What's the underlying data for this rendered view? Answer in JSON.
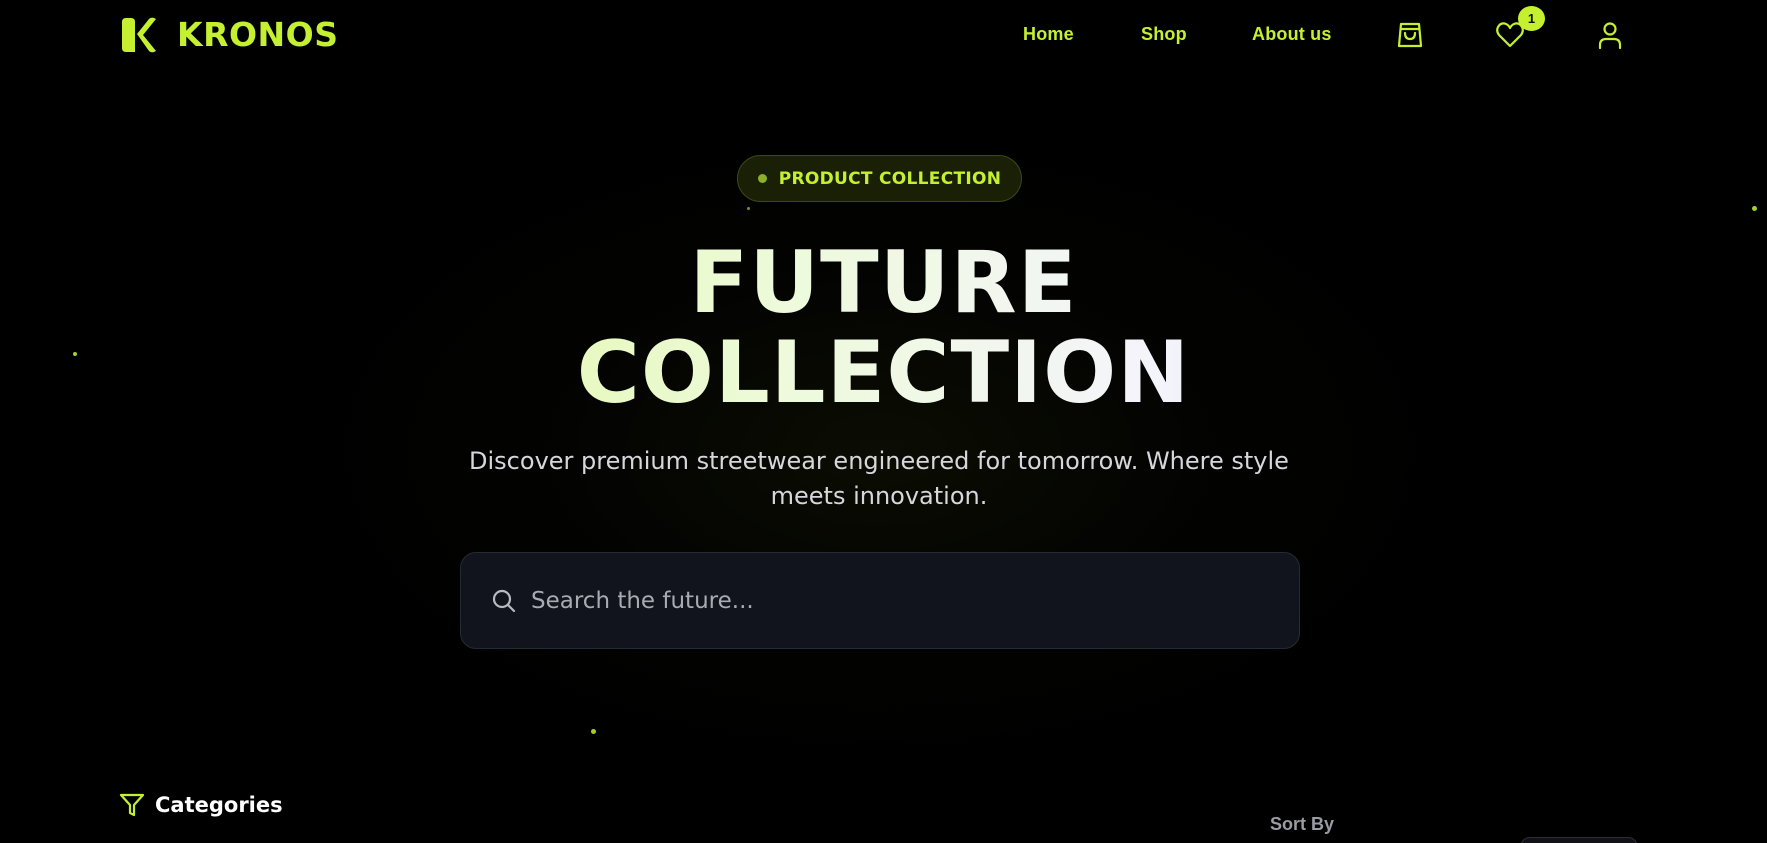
{
  "brand": {
    "name": "KRONOS",
    "logo_icon": "kronos-logo-icon",
    "accent_color": "#c5f030"
  },
  "nav": {
    "links": [
      {
        "label": "Home"
      },
      {
        "label": "Shop"
      },
      {
        "label": "About us"
      }
    ],
    "icons": {
      "cart": "shopping-bag-icon",
      "wishlist": "heart-icon",
      "account": "user-icon"
    },
    "wishlist_count": "1"
  },
  "hero": {
    "badge_label": "PRODUCT COLLECTION",
    "title_line1": "FUTURE",
    "title_line2": "COLLECTION",
    "subtitle": "Discover premium streetwear engineered for tomorrow. Where style meets innovation.",
    "search_placeholder": "Search the future..."
  },
  "filters": {
    "categories_label": "Categories",
    "sort_label": "Sort By"
  }
}
